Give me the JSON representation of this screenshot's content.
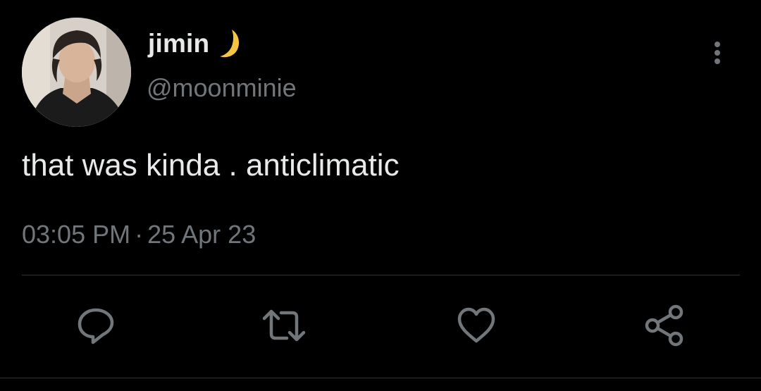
{
  "tweet": {
    "author": {
      "display_name": "jimin",
      "name_emoji": "moon-icon",
      "handle": "@moonminie",
      "avatar": "avatar-photo"
    },
    "text": "that was kinda . anticlimatic",
    "time": "03:05 PM",
    "separator": "·",
    "date": "25 Apr 23"
  },
  "actions": {
    "reply": "reply-icon",
    "retweet": "retweet-icon",
    "like": "like-icon",
    "share": "share-icon",
    "more": "more-options-icon"
  },
  "colors": {
    "background": "#000000",
    "primary_text": "#e7e9ea",
    "secondary_text": "#71767b",
    "divider": "#2f3336",
    "moon": "#f5c542"
  }
}
